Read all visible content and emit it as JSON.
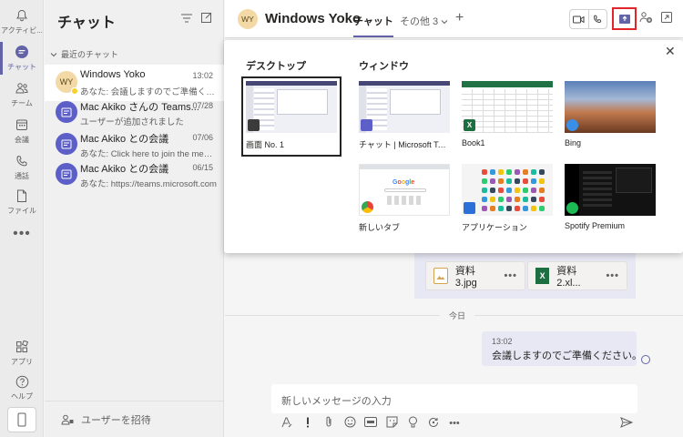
{
  "rail": {
    "items": [
      {
        "label": "アクティビ...",
        "icon": "bell-icon"
      },
      {
        "label": "チャット",
        "icon": "chat-icon",
        "active": true
      },
      {
        "label": "チーム",
        "icon": "teams-icon"
      },
      {
        "label": "会議",
        "icon": "calendar-icon"
      },
      {
        "label": "通話",
        "icon": "phone-icon"
      },
      {
        "label": "ファイル",
        "icon": "file-icon"
      }
    ],
    "more": "•••",
    "apps_label": "アプリ",
    "help_label": "ヘルプ"
  },
  "chatlist": {
    "title": "チャット",
    "section": "最近のチャット",
    "chats": [
      {
        "initials": "WY",
        "name": "Windows Yoko",
        "preview": "あなた: 会議しますのでご準備くださ",
        "date": "13:02"
      },
      {
        "initials": "",
        "name": "Mac Akiko さんの Teams...",
        "preview": "ユーザーが追加されました",
        "date": "07/28"
      },
      {
        "initials": "",
        "name": "Mac Akiko との会議",
        "preview": "あなた: Click here to join the meeting",
        "date": "07/06"
      },
      {
        "initials": "",
        "name": "Mac Akiko との会議",
        "preview": "あなた: https://teams.microsoft.com",
        "date": "06/15"
      }
    ],
    "invite_label": "ユーザーを招待"
  },
  "topbar": {
    "avatar_initials": "WY",
    "name": "Windows Yoko",
    "tab_chat": "チャット",
    "tab_more": "その他 3",
    "add_tab": "+"
  },
  "share_panel": {
    "desktop_heading": "デスクトップ",
    "window_heading": "ウィンドウ",
    "desktop": {
      "label": "画面 No. 1"
    },
    "windows": [
      {
        "label": "チャット | Microsoft Teams",
        "app": "teams"
      },
      {
        "label": "Book1",
        "app": "excel"
      },
      {
        "label": "Bing",
        "app": "edge"
      },
      {
        "label": "新しいタブ",
        "app": "chrome"
      },
      {
        "label": "アプリケーション",
        "app": "finder"
      },
      {
        "label": "Spotify Premium",
        "app": "spotify"
      }
    ],
    "google_logo": "Google",
    "excel_badge": "X"
  },
  "conversation": {
    "attachments": [
      {
        "name": "資料3.jpg",
        "more": "•••"
      },
      {
        "name": "資料2.xl...",
        "more": "•••"
      }
    ],
    "day_label": "今日",
    "message": {
      "time": "13:02",
      "text": "会議しますのでご準備ください。"
    }
  },
  "compose": {
    "placeholder": "新しいメッセージの入力",
    "tools": [
      "format-icon",
      "important-icon",
      "attach-icon",
      "emoji-icon",
      "gif-icon",
      "sticker-icon",
      "meet-icon",
      "loop-icon",
      "more-icon"
    ]
  },
  "colors": {
    "accent": "#6264a7",
    "highlight": "#e0262a"
  }
}
